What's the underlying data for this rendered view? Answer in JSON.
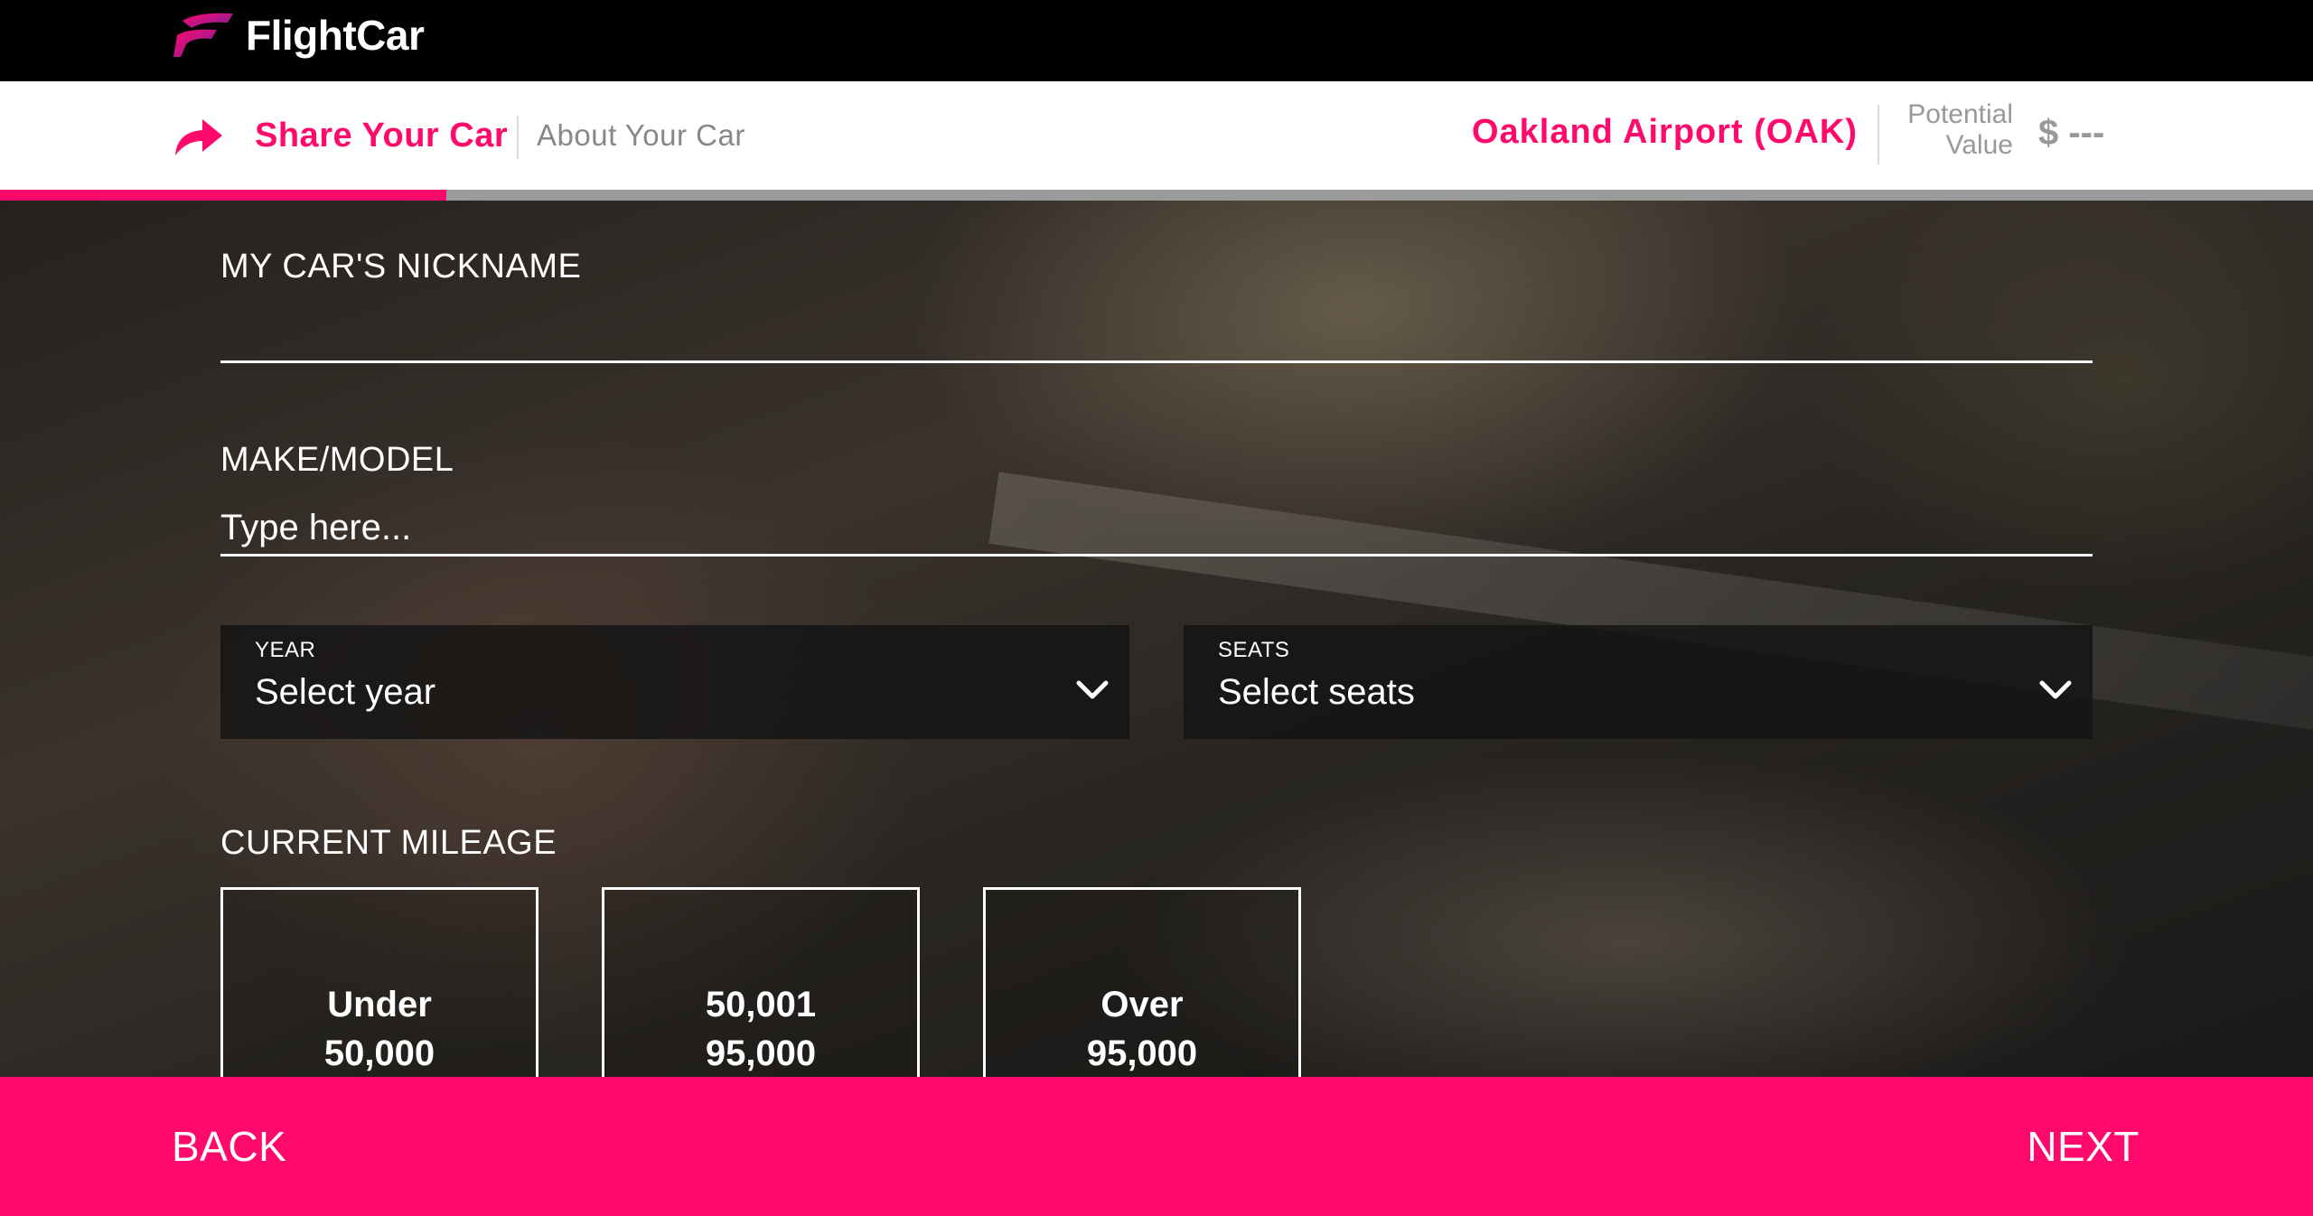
{
  "app": {
    "brand": "FlightCar",
    "brand_color": "#ff0a6c"
  },
  "header": {
    "step_current": "Share Your Car",
    "step_next": "About Your Car",
    "airport": "Oakland Airport (OAK)",
    "potential_line1": "Potential",
    "potential_line2": "Value",
    "value": "$ ---"
  },
  "progress": {
    "fraction": 0.193
  },
  "form": {
    "nickname": {
      "label": "MY CAR'S NICKNAME",
      "value": ""
    },
    "make_model": {
      "label": "MAKE/MODEL",
      "placeholder": "Type here...",
      "value": ""
    },
    "year": {
      "label": "YEAR",
      "selected": "Select year"
    },
    "seats": {
      "label": "SEATS",
      "selected": "Select seats"
    },
    "mileage": {
      "label": "CURRENT MILEAGE",
      "options": [
        {
          "line1": "Under",
          "line2": "50,000"
        },
        {
          "line1": "50,001",
          "line2": "95,000"
        },
        {
          "line1": "Over",
          "line2": "95,000"
        }
      ]
    }
  },
  "footer": {
    "back_label": "BACK",
    "next_label": "NEXT"
  },
  "icons": {
    "logo": "flightcar-logo-icon",
    "step": "share-arrow-icon",
    "dropdown": "chevron-down-icon"
  }
}
